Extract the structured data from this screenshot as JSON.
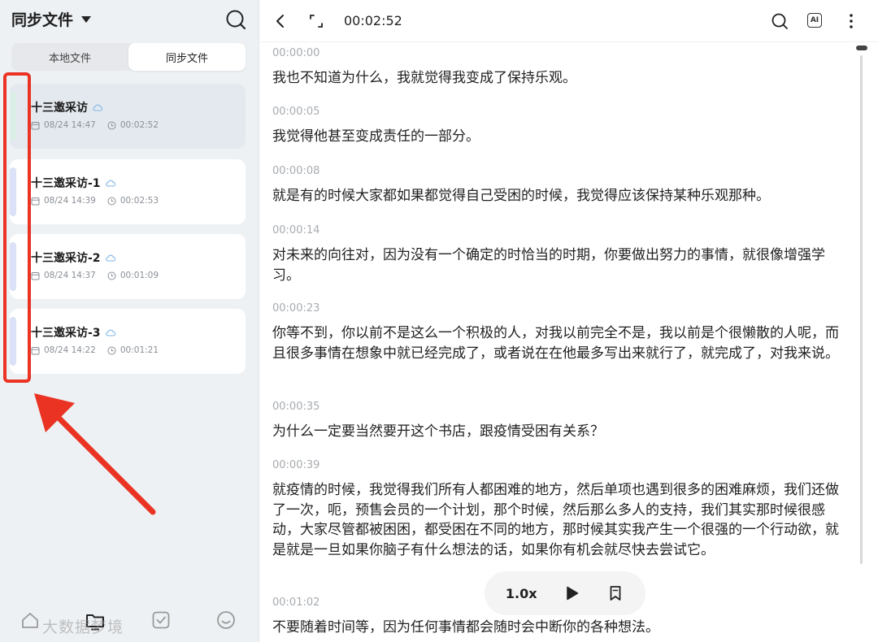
{
  "sidebar": {
    "title": "同步文件",
    "segments": [
      "本地文件",
      "同步文件"
    ],
    "active_segment": 1,
    "files": [
      {
        "name": "十三邀采访",
        "date": "08/24 14:47",
        "duration": "00:02:52",
        "selected": true
      },
      {
        "name": "十三邀采访-1",
        "date": "08/24 14:39",
        "duration": "00:02:53",
        "selected": false
      },
      {
        "name": "十三邀采访-2",
        "date": "08/24 14:37",
        "duration": "00:01:09",
        "selected": false
      },
      {
        "name": "十三邀采访-3",
        "date": "08/24 14:22",
        "duration": "00:01:21",
        "selected": false
      }
    ],
    "watermark": "大数据梦境"
  },
  "topbar": {
    "duration": "00:02:52",
    "ai_label": "AI"
  },
  "transcript": [
    {
      "time": "00:00:00",
      "text": "我也不知道为什么，我就觉得我变成了保持乐观。"
    },
    {
      "time": "00:00:05",
      "text": "我觉得他甚至变成责任的一部分。"
    },
    {
      "time": "00:00:08",
      "text": "就是有的时候大家都如果都觉得自己受困的时候，我觉得应该保持某种乐观那种。"
    },
    {
      "time": "00:00:14",
      "text": "对未来的向往对，因为没有一个确定的时恰当的时期，你要做出努力的事情，就很像增强学习。"
    },
    {
      "time": "00:00:23",
      "text": "你等不到，你以前不是这么一个积极的人，对我以前完全不是，我以前是个很懒散的人呢，而且很多事情在想象中就已经完成了，或者说在在他最多写出来就行了，就完成了，对我来说。"
    },
    {
      "time": "00:00:35",
      "text": "为什么一定要当然要开这个书店，跟疫情受困有关系？"
    },
    {
      "time": "00:00:39",
      "text": "就疫情的时候，我觉得我们所有人都困难的地方，然后单项也遇到很多的困难麻烦，我们还做了一次，呃，预售会员的一个计划，那个时候，然后那么多人的支持，我们其实那时候很感动，大家尽管都被困困，都受困在不同的地方，那时候其实我产生一个很强的一个行动欲，就是就是一旦如果你脑子有什么想法的话，如果你有机会就尽快去尝试它。"
    },
    {
      "time": "00:01:02",
      "text": "不要随着时间等，因为任何事情都会随时会中断你的各种想法。"
    }
  ],
  "player": {
    "speed": "1.0x"
  },
  "colors": {
    "highlight": "#ea3323",
    "sidebar_bg": "#eef1f4",
    "timestamp": "#a7abb0"
  }
}
